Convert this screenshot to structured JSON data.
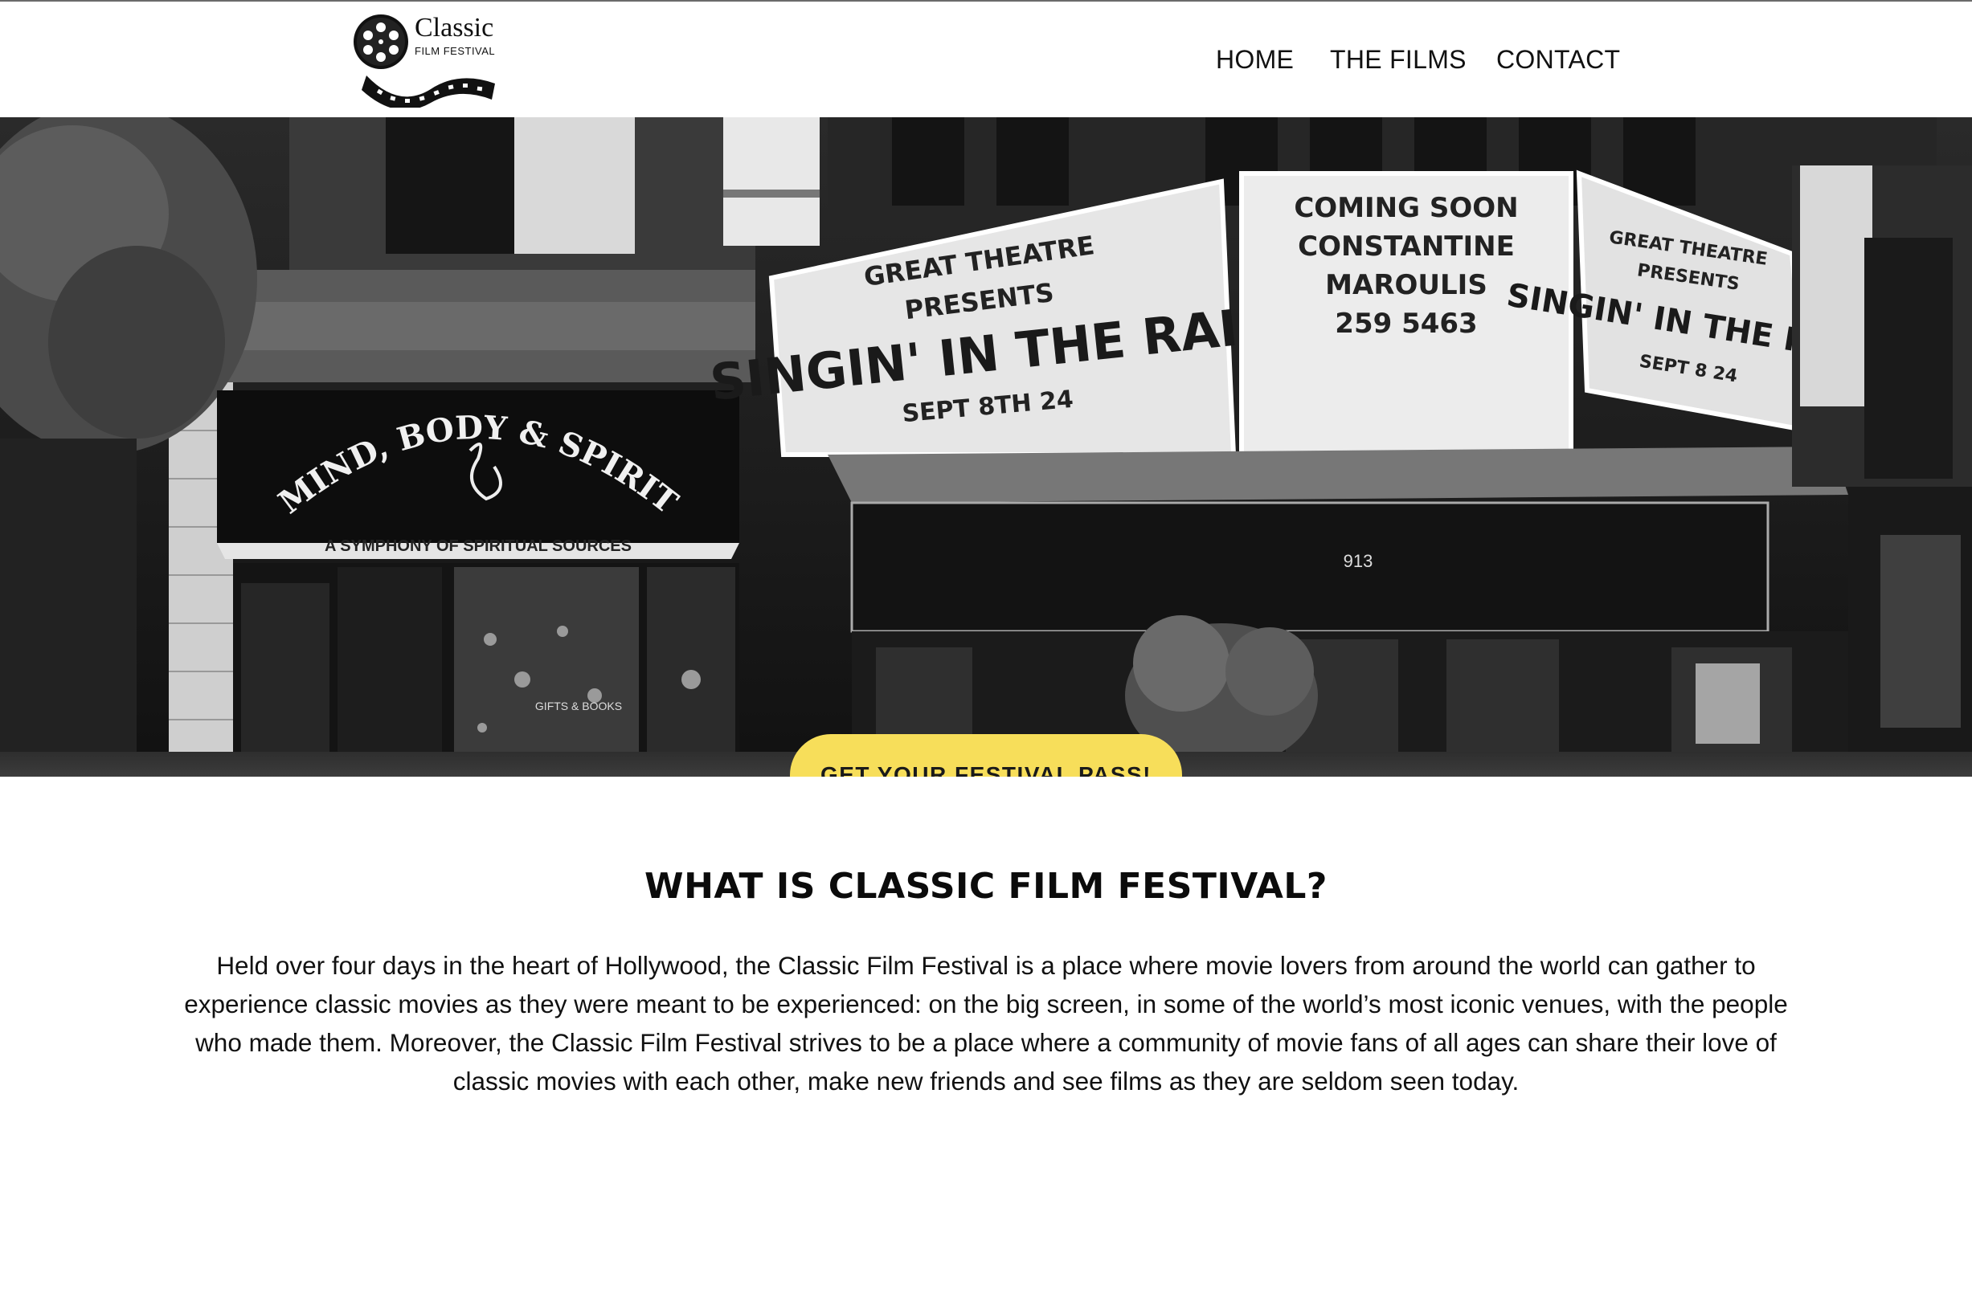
{
  "brand": {
    "logo_line1": "Classic",
    "logo_line2": "FILM FESTIVAL"
  },
  "nav": {
    "items": [
      {
        "label": "HOME"
      },
      {
        "label": "THE FILMS"
      },
      {
        "label": "CONTACT"
      }
    ]
  },
  "hero": {
    "cta_label": "GET YOUR FESTIVAL PASS!",
    "cta_color": "#f7de5a",
    "photo_signs": {
      "awning_arc": "MIND, BODY & SPIRIT",
      "awning_sub": "A SYMPHONY OF SPIRITUAL SOURCES",
      "marquee_left_l1": "GREAT THEATRE",
      "marquee_left_l2": "PRESENTS",
      "marquee_left_l3": "SINGIN' IN THE RAIN",
      "marquee_left_l4": "SEPT 8TH 24",
      "marquee_mid_l1": "COMING SOON",
      "marquee_mid_l2": "CONSTANTINE",
      "marquee_mid_l3": "MAROULIS",
      "marquee_mid_l4": "259 5463",
      "marquee_right_l1": "GREAT THEATRE",
      "marquee_right_l2": "PRESENTS",
      "marquee_right_l3": "SINGIN' IN THE RAIN",
      "marquee_right_l4": "SEPT 8 24",
      "door_number": "913",
      "shop_window": "GIFTS & BOOKS"
    }
  },
  "about": {
    "title": "WHAT IS CLASSIC FILM FESTIVAL?",
    "body": "Held over four days in the heart of Hollywood, the Classic Film Festival is a place where movie lovers from around the world can gather to experience classic movies as they were meant to be experienced: on the big screen, in some of the world’s most iconic venues, with the people who made them. Moreover, the Classic Film Festival strives to be a place where a community of movie fans of all ages can share their love of classic movies with each other, make new friends and see films as they are seldom seen today."
  }
}
